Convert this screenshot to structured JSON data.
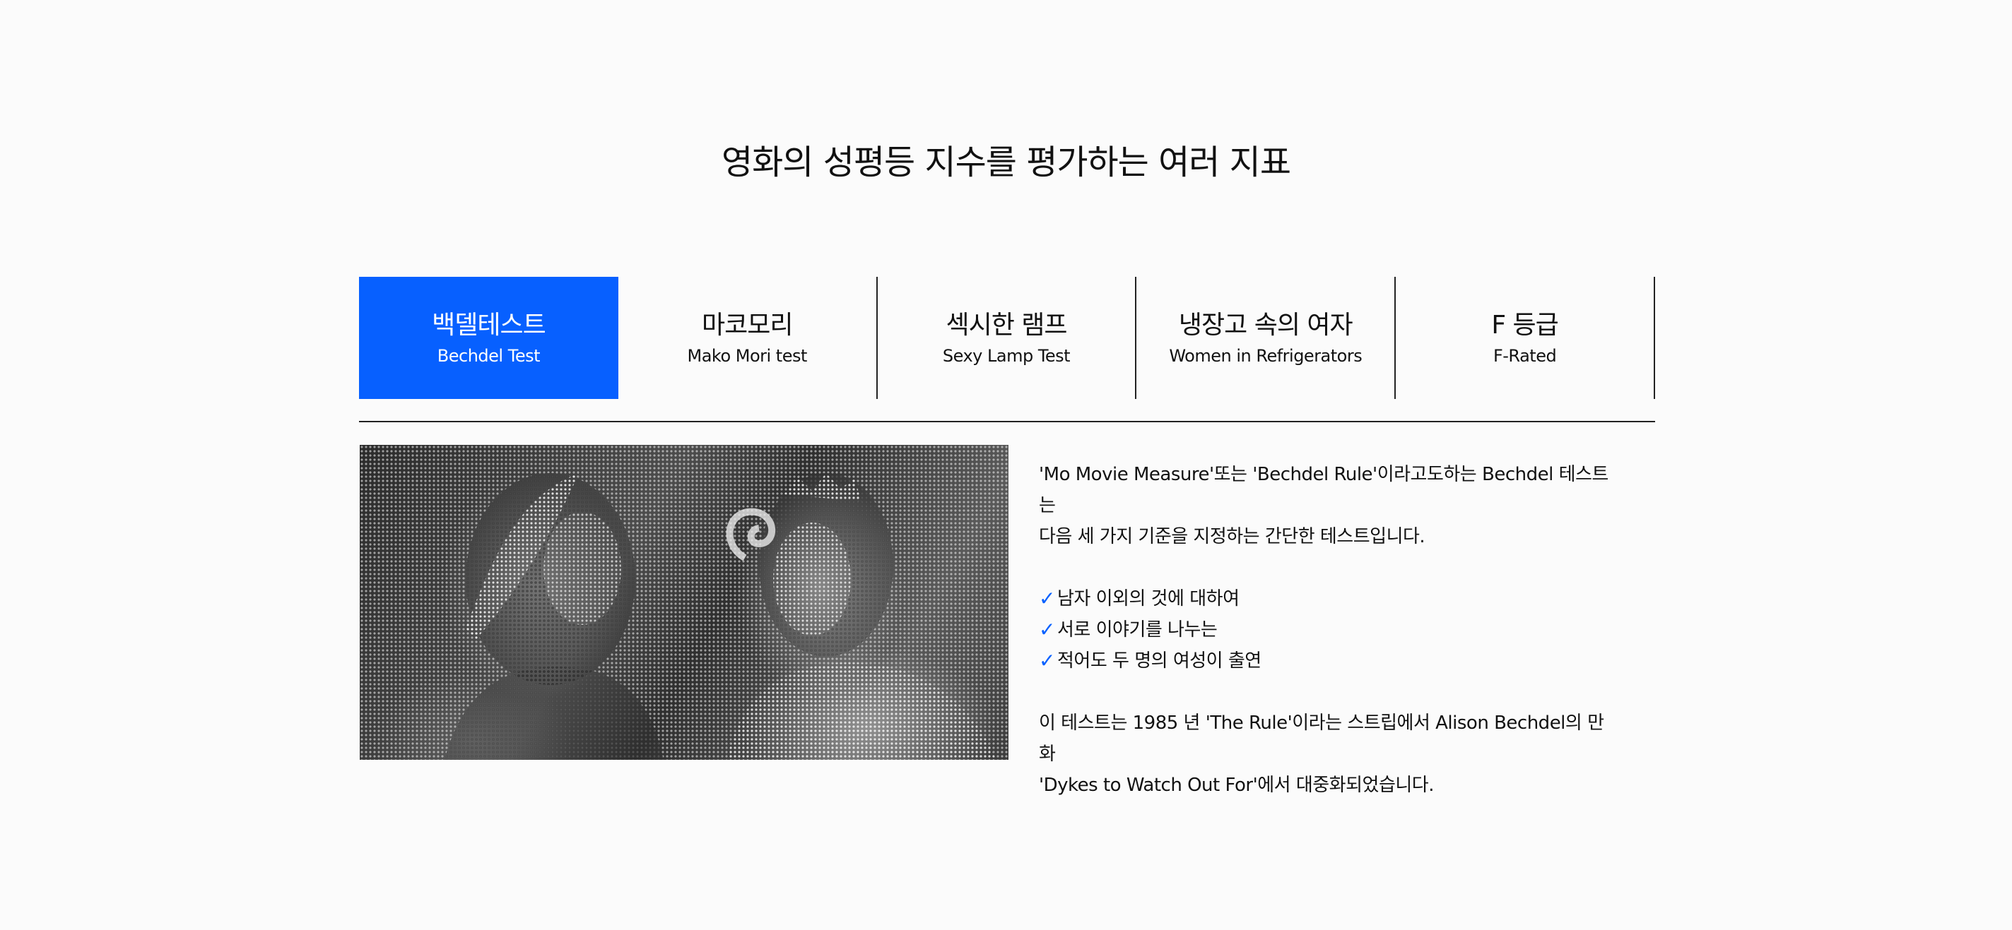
{
  "page": {
    "title": "영화의 성평등 지수를 평가하는 여러 지표"
  },
  "tabs": [
    {
      "ko": "백델테스트",
      "en": "Bechdel Test",
      "active": true
    },
    {
      "ko": "마코모리",
      "en": "Mako Mori test",
      "active": false
    },
    {
      "ko": "섹시한 램프",
      "en": "Sexy Lamp Test",
      "active": false
    },
    {
      "ko": "냉장고 속의 여자",
      "en": "Women in Refrigerators",
      "active": false
    },
    {
      "ko": "F 등급",
      "en": "F-Rated",
      "active": false
    }
  ],
  "content": {
    "intro_line1": "'Mo Movie Measure'또는 'Bechdel Rule'이라고도하는 Bechdel 테스트는",
    "intro_line2": "다음 세 가지 기준을 지정하는 간단한 테스트입니다.",
    "criteria": [
      "남자 이외의 것에 대하여",
      " 서로 이야기를 나누는",
      "적어도 두 명의 여성이 출연"
    ],
    "origin_line1": "이 테스트는 1985 년 'The Rule'이라는 스트립에서 Alison Bechdel의 만화",
    "origin_line2": "'Dykes to Watch Out For'에서 대중화되었습니다.",
    "check_icon": "✓"
  },
  "colors": {
    "accent": "#0760ff",
    "background": "#fbfbfb",
    "text": "#111111"
  },
  "image": {
    "icon": "halftone-photo-two-women"
  }
}
